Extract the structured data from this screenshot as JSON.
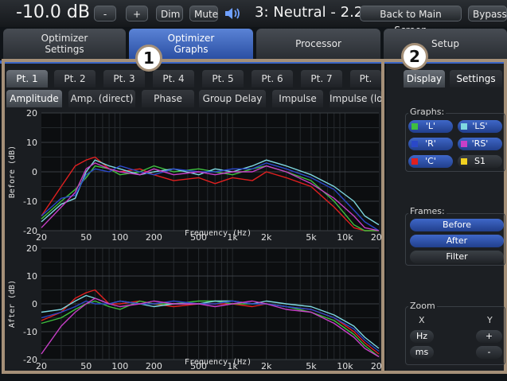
{
  "topbar": {
    "volume": "-10.0 dB",
    "minus_label": "-",
    "plus_label": "+",
    "dim_label": "Dim",
    "mute_label": "Mute",
    "preset": "3: Neutral - 2.2",
    "back_label": "Back to Main Screen",
    "bypass_label": "Bypass"
  },
  "main_tabs": [
    {
      "label1": "Optimizer",
      "label2": "Settings"
    },
    {
      "label1": "Optimizer",
      "label2": "Graphs"
    },
    {
      "label1": "Processor",
      "label2": ""
    },
    {
      "label1": "Setup",
      "label2": ""
    }
  ],
  "badges": {
    "one": "1",
    "two": "2"
  },
  "point_tabs": [
    "Pt. 1",
    "Pt. 2",
    "Pt. 3",
    "Pt. 4",
    "Pt. 5",
    "Pt. 6",
    "Pt. 7",
    "Pt."
  ],
  "view_tabs": [
    "Amplitude",
    "Amp. (direct)",
    "Phase",
    "Group Delay",
    "Impulse",
    "Impulse (lo"
  ],
  "right_tabs": {
    "display": "Display",
    "settings": "Settings"
  },
  "graphs": {
    "label": "Graphs:",
    "channels": [
      {
        "name": "'L'",
        "color": "#3fbf3f"
      },
      {
        "name": "'LS'",
        "color": "#7fd8e0"
      },
      {
        "name": "'R'",
        "color": "#2a48c8"
      },
      {
        "name": "'RS'",
        "color": "#c83fc8"
      },
      {
        "name": "'C'",
        "color": "#e02020"
      },
      {
        "name": "S1",
        "color": "#f0d020"
      }
    ]
  },
  "frames": {
    "label": "Frames:",
    "before": "Before",
    "after": "After",
    "filter": "Filter"
  },
  "zoom": {
    "label": "Zoom",
    "x_label": "X",
    "y_label": "Y",
    "hz": "Hz",
    "ms": "ms",
    "plus": "+",
    "minus": "-"
  },
  "chart_data": [
    {
      "type": "line",
      "ylabel": "Before (dB)",
      "xlabel": "Frequency (Hz)",
      "xscale": "log",
      "xlim": [
        20,
        20000
      ],
      "ylim": [
        -20,
        20
      ],
      "xticks": [
        "20",
        "50",
        "100",
        "200",
        "500",
        "1k",
        "2k",
        "5k",
        "10k",
        "20k"
      ],
      "yticks": [
        "20",
        "10",
        "0",
        "-10",
        "-20"
      ],
      "grid": true,
      "x": [
        20,
        30,
        40,
        50,
        60,
        80,
        100,
        150,
        200,
        300,
        500,
        700,
        1000,
        1500,
        2000,
        3000,
        5000,
        8000,
        12000,
        15000,
        20000
      ],
      "series": [
        {
          "color": "#e02020",
          "values": [
            -15,
            -5,
            2,
            4,
            5,
            1,
            0,
            1,
            -1,
            -3,
            -2,
            -4,
            -2,
            -3,
            0,
            -2,
            -5,
            -12,
            -19,
            -20,
            -20
          ]
        },
        {
          "color": "#3fbf3f",
          "values": [
            -16,
            -10,
            -6,
            -2,
            2,
            1,
            -1,
            0,
            2,
            0,
            1,
            0,
            -1,
            1,
            2,
            0,
            -3,
            -10,
            -18,
            -20,
            -20
          ]
        },
        {
          "color": "#7fd8e0",
          "values": [
            -17,
            -11,
            -9,
            0,
            4,
            2,
            1,
            -1,
            0,
            1,
            -1,
            1,
            0,
            2,
            4,
            2,
            -1,
            -5,
            -10,
            -15,
            -18
          ]
        },
        {
          "color": "#2a48c8",
          "values": [
            -15,
            -9,
            -8,
            -1,
            1,
            0,
            2,
            0,
            -1,
            1,
            0,
            0,
            1,
            1,
            3,
            1,
            -2,
            -6,
            -13,
            -17,
            -20
          ]
        },
        {
          "color": "#c83fc8",
          "values": [
            -19,
            -12,
            -7,
            1,
            3,
            1,
            0,
            -1,
            1,
            -1,
            0,
            -1,
            0,
            0,
            2,
            0,
            -4,
            -9,
            -15,
            -19,
            -20
          ]
        }
      ]
    },
    {
      "type": "line",
      "ylabel": "After (dB)",
      "xlabel": "Frequency (Hz)",
      "xscale": "log",
      "xlim": [
        20,
        20000
      ],
      "ylim": [
        -20,
        20
      ],
      "xticks": [
        "20",
        "50",
        "100",
        "200",
        "500",
        "1k",
        "2k",
        "5k",
        "10k",
        "20k"
      ],
      "yticks": [
        "20",
        "10",
        "0",
        "-10",
        "-20"
      ],
      "grid": true,
      "x": [
        20,
        30,
        40,
        50,
        60,
        80,
        100,
        150,
        200,
        300,
        500,
        700,
        1000,
        1500,
        2000,
        3000,
        5000,
        8000,
        12000,
        15000,
        20000
      ],
      "series": [
        {
          "color": "#e02020",
          "values": [
            -6,
            -3,
            2,
            4,
            5,
            0,
            0,
            1,
            0,
            -1,
            0,
            0,
            0,
            -1,
            0,
            -1,
            -2,
            -5,
            -10,
            -14,
            -18
          ]
        },
        {
          "color": "#3fbf3f",
          "values": [
            -7,
            -5,
            -2,
            0,
            1,
            -1,
            -2,
            1,
            0,
            0,
            1,
            1,
            0,
            0,
            0,
            -1,
            -3,
            -6,
            -11,
            -15,
            -19
          ]
        },
        {
          "color": "#7fd8e0",
          "values": [
            -3,
            -2,
            1,
            3,
            2,
            0,
            1,
            0,
            -1,
            0,
            0,
            1,
            1,
            0,
            1,
            0,
            -1,
            -4,
            -8,
            -12,
            -16
          ]
        },
        {
          "color": "#2a48c8",
          "values": [
            -5,
            -3,
            -1,
            1,
            0,
            0,
            1,
            0,
            0,
            1,
            0,
            0,
            1,
            0,
            0,
            -1,
            -2,
            -5,
            -9,
            -13,
            -17
          ]
        },
        {
          "color": "#c83fc8",
          "values": [
            -18,
            -8,
            -3,
            0,
            2,
            0,
            -1,
            0,
            1,
            0,
            0,
            -1,
            0,
            1,
            0,
            -2,
            -3,
            -7,
            -12,
            -16,
            -19
          ]
        }
      ]
    }
  ]
}
